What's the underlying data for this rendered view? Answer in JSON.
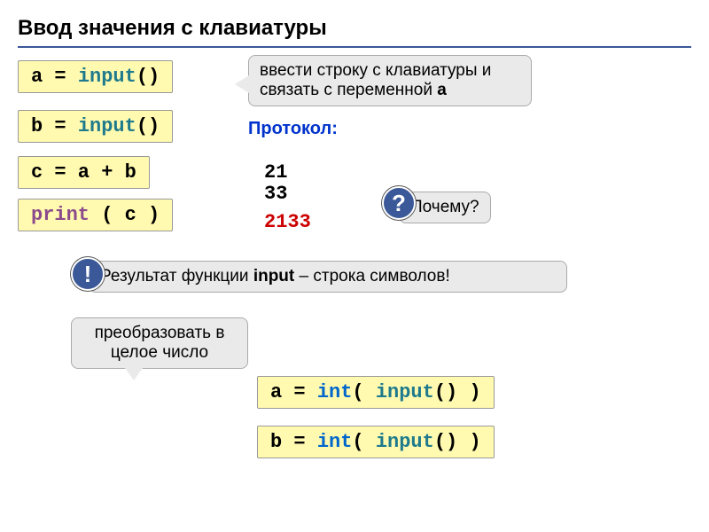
{
  "title": "Ввод значения с клавиатуры",
  "codes": {
    "a_input_pre": "a = ",
    "a_input_fn": "input",
    "a_input_post": "()",
    "b_input_pre": "b = ",
    "b_input_fn": "input",
    "b_input_post": "()",
    "c_sum": "c = a + b",
    "print_pre": "",
    "print_fn": "print",
    "print_post": " ( c )",
    "aint_pre": "a = ",
    "aint_int": "int",
    "aint_mid": "( ",
    "aint_fn": "input",
    "aint_post": "() )",
    "bint_pre": "b = ",
    "bint_int": "int",
    "bint_mid": "( ",
    "bint_fn": "input",
    "bint_post": "() )"
  },
  "callouts": {
    "top_pre": "ввести строку с клавиатуры и связать с переменной ",
    "top_var": "a",
    "why": "Почему?",
    "result_pre": "Результат функции ",
    "result_fn": "input",
    "result_post": " – строка символов!",
    "convert": "преобразовать в целое число"
  },
  "protocol": {
    "label": "Протокол:",
    "v1": "21",
    "v2": "33",
    "v3": "2133"
  },
  "badges": {
    "question": "?",
    "exclaim": "!"
  }
}
